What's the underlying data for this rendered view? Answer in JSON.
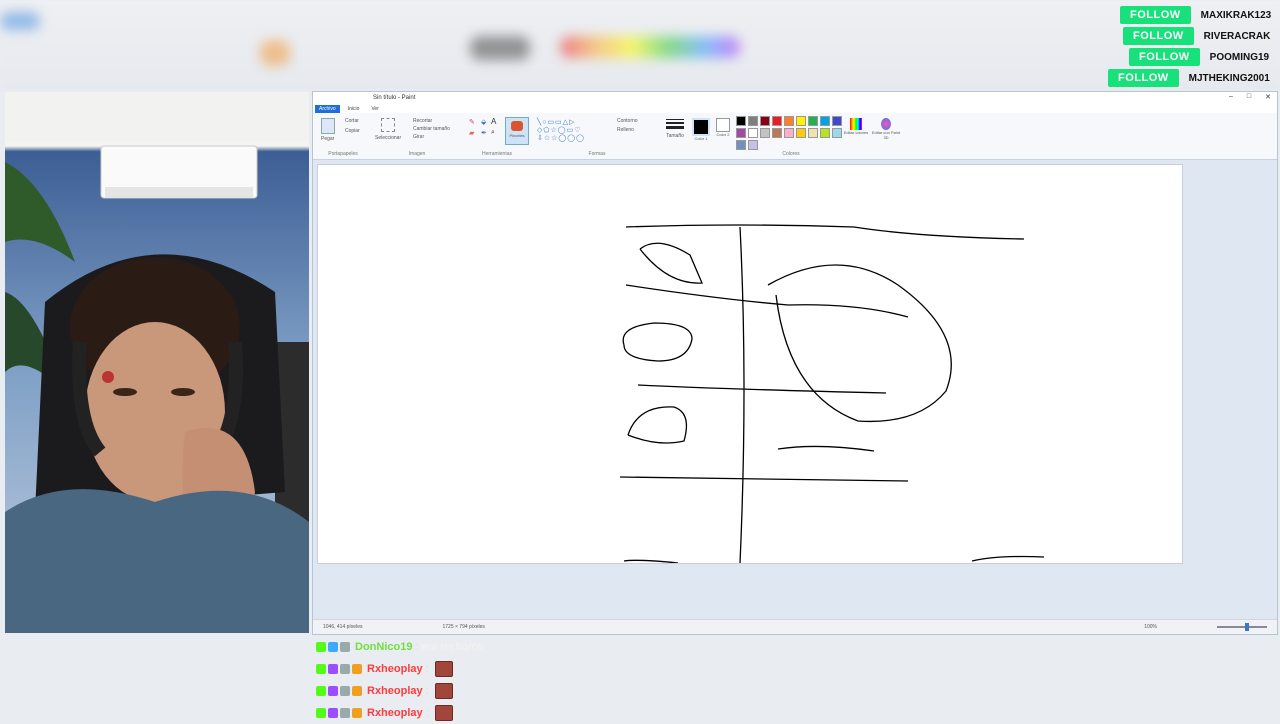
{
  "follows": [
    {
      "button": "FOLLOW",
      "name": "MAXIKRAK123"
    },
    {
      "button": "FOLLOW",
      "name": "RIVERACRAK"
    },
    {
      "button": "FOLLOW",
      "name": "POOMING19"
    },
    {
      "button": "FOLLOW",
      "name": "MJTHEKING2001"
    }
  ],
  "paint": {
    "title": "Sin título - Paint",
    "tabs": [
      "Archivo",
      "Inicio",
      "Ver"
    ],
    "groups": [
      "Portapapeles",
      "Imagen",
      "Herramientas",
      "Formas",
      "Colores"
    ],
    "clipboard": {
      "paste": "Pegar",
      "cut": "Cortar",
      "copy": "Copiar"
    },
    "image": {
      "select": "Seleccionar",
      "crop": "Recortar",
      "resize": "Cambiar tamaño",
      "rotate": "Girar"
    },
    "brushes": "Pinceles",
    "size": "Tamaño",
    "color1": "Color 1",
    "color2": "Color 2",
    "edit_colors": "Editar colores",
    "edit_3d": "Editar con Paint 3D",
    "outline": "Contorno",
    "fill": "Relleno",
    "status": {
      "cursor": "1046, 414 píxeles",
      "size": "1725 × 794 píxeles",
      "zoom": "100%"
    },
    "palette": [
      "#000000",
      "#7f7f7f",
      "#880015",
      "#ed1c24",
      "#ff7f27",
      "#fff200",
      "#22b14c",
      "#00a2e8",
      "#3f48cc",
      "#a349a4",
      "#ffffff",
      "#c3c3c3",
      "#b97a57",
      "#ffaec9",
      "#ffc90e",
      "#efe4b0",
      "#b5e61d",
      "#99d9ea",
      "#7092be",
      "#c8bfe7"
    ]
  },
  "chat": [
    {
      "user": "DonNico19",
      "message": "era un barco",
      "user_color": "#6fe040"
    },
    {
      "user": "Rxheoplay",
      "message": "",
      "user_color": "#ff3b3b"
    },
    {
      "user": "Rxheoplay",
      "message": "",
      "user_color": "#ff3b3b"
    },
    {
      "user": "Rxheoplay",
      "message": "",
      "user_color": "#ff3b3b"
    }
  ]
}
